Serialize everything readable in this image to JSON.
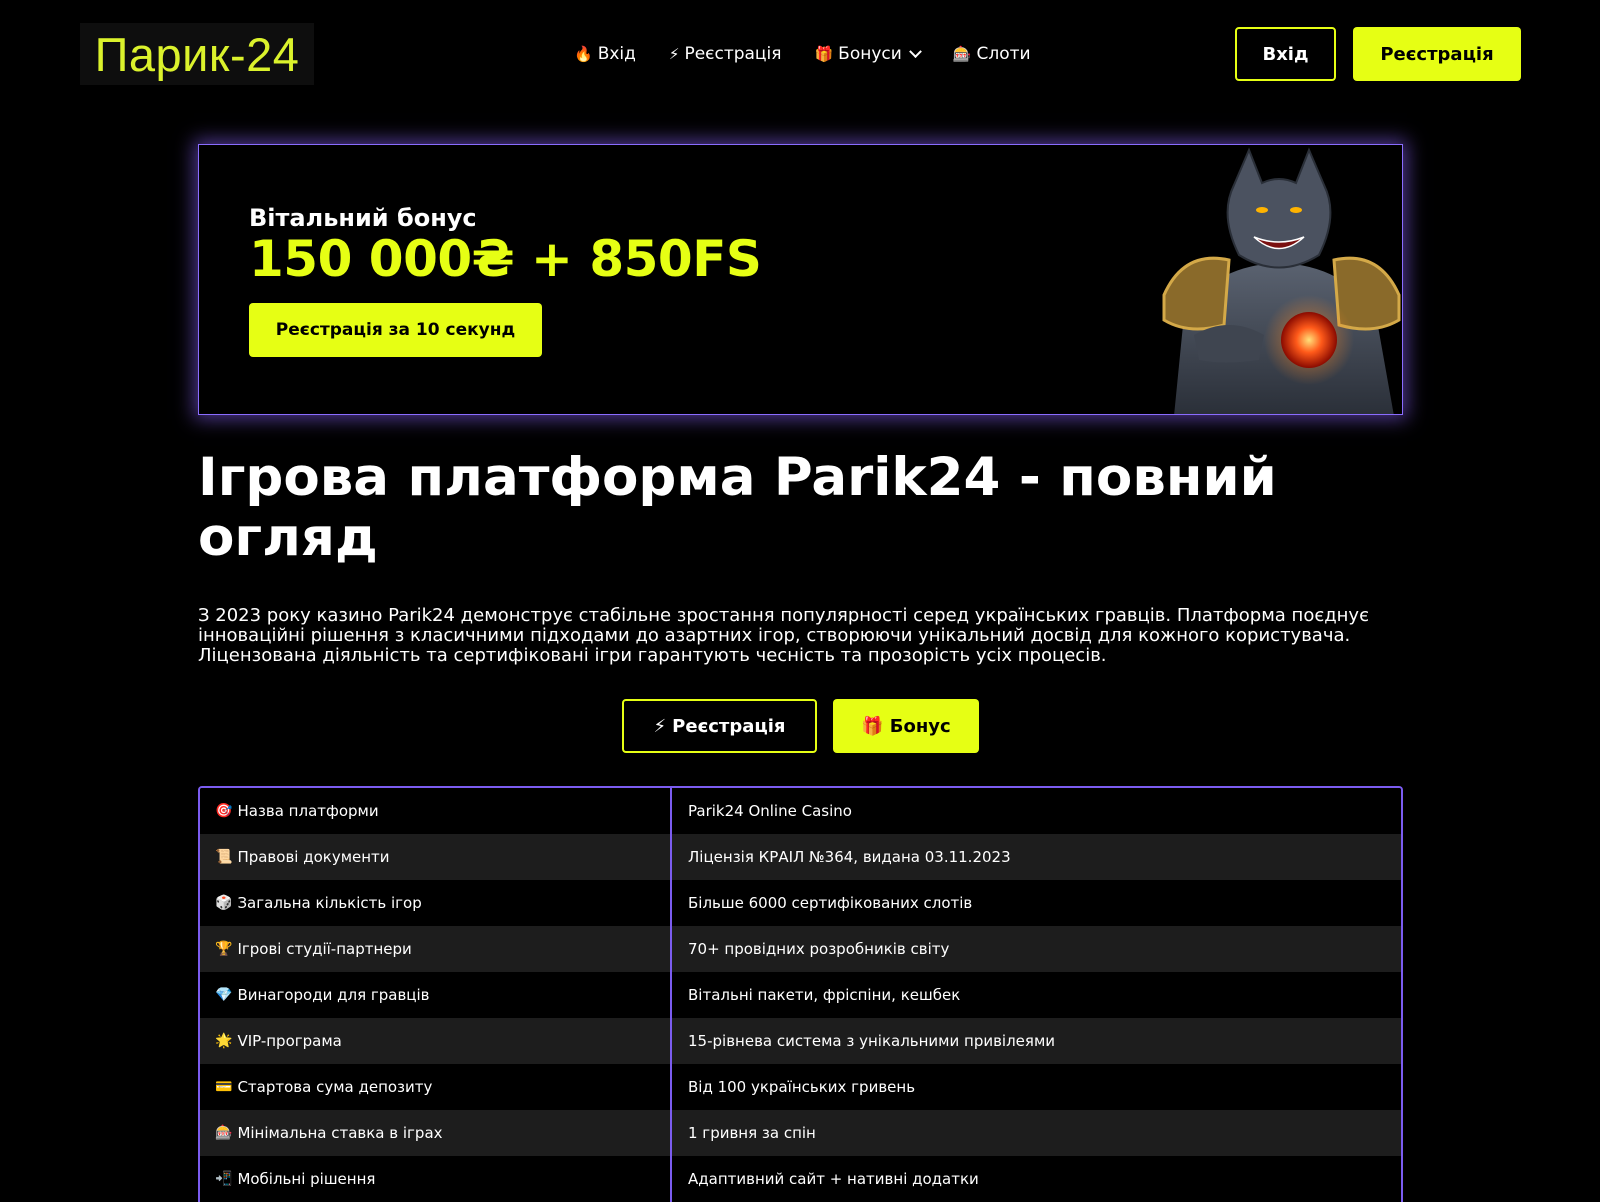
{
  "header": {
    "logo_text": "Парик-24",
    "nav": [
      {
        "icon": "🔥",
        "label": "Вхід"
      },
      {
        "icon": "⚡",
        "label": "Реєстрація"
      },
      {
        "icon": "🎁",
        "label": "Бонуси"
      },
      {
        "icon": "🎰",
        "label": "Слоти"
      }
    ],
    "login_label": "Вхід",
    "register_label": "Реєстрація"
  },
  "banner": {
    "subtitle": "Вітальний бонус",
    "amount": "150 000₴ + 850FS",
    "cta_label": "Реєстрація за 10 секунд"
  },
  "main": {
    "title": "Ігрова платформа Parik24 - повний огляд",
    "intro": "З 2023 року казино Parik24 демонструє стабільне зростання популярності серед українських гравців. Платформа поєднує інноваційні рішення з класичними підходами до азартних ігор, створюючи унікальний досвід для кожного користувача. Ліцензована діяльність та сертифіковані ігри гарантують чесність та прозорість усіх процесів.",
    "cta_register": {
      "icon": "⚡",
      "label": "Реєстрація"
    },
    "cta_bonus": {
      "icon": "🎁",
      "label": "Бонус"
    }
  },
  "table": [
    {
      "icon": "🎯",
      "key": "Назва платформи",
      "value": "Parik24 Online Casino"
    },
    {
      "icon": "📜",
      "key": "Правові документи",
      "value": "Ліцензія КРАІЛ №364, видана 03.11.2023"
    },
    {
      "icon": "🎲",
      "key": "Загальна кількість ігор",
      "value": "Більше 6000 сертифікованих слотів"
    },
    {
      "icon": "🏆",
      "key": "Ігрові студії-партнери",
      "value": "70+ провідних розробників світу"
    },
    {
      "icon": "💎",
      "key": "Винагороди для гравців",
      "value": "Вітальні пакети, фріспіни, кешбек"
    },
    {
      "icon": "🌟",
      "key": "VIP-програма",
      "value": "15-рівнева система з унікальними привілеями"
    },
    {
      "icon": "💳",
      "key": "Стартова сума депозиту",
      "value": "Від 100 українських гривень"
    },
    {
      "icon": "🎰",
      "key": "Мінімальна ставка в іграх",
      "value": "1 гривня за спін"
    },
    {
      "icon": "📲",
      "key": "Мобільні рішення",
      "value": "Адаптивний сайт + нативні додатки"
    }
  ],
  "colors": {
    "accent": "#e6ff14",
    "logo": "#dbf22c",
    "border_purple": "#7b5cf0",
    "row_alt": "#1d1d1d"
  }
}
